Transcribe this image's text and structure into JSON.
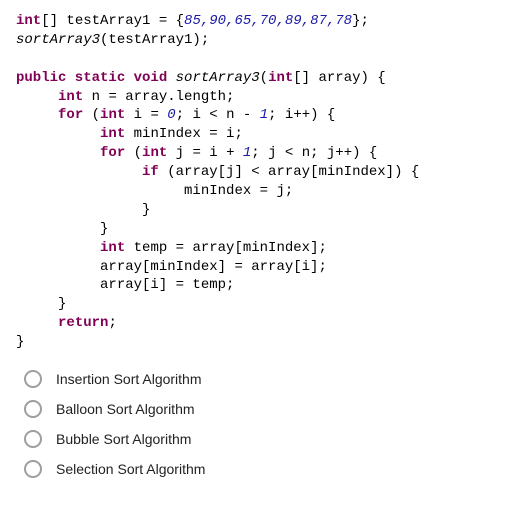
{
  "code": {
    "line1_a": "int",
    "line1_b": "[] testArray1 = {",
    "line1_nums": "85,90,65,70,89,87,78",
    "line1_c": "};",
    "line2_fn": "sortArray3",
    "line2_rest": "(testArray1);",
    "line3_a": "public static void ",
    "line3_fn": "sortArray3",
    "line3_b": "(",
    "line3_c": "int",
    "line3_d": "[] array) {",
    "line4_a": "int",
    "line4_b": " n = array.length;",
    "line5_a": "for",
    "line5_b": " (",
    "line5_c": "int",
    "line5_d": " i = ",
    "line5_n0": "0",
    "line5_e": "; i < n - ",
    "line5_n1": "1",
    "line5_f": "; i++) {",
    "line6_a": "int",
    "line6_b": " minIndex = i;",
    "line7_a": "for",
    "line7_b": " (",
    "line7_c": "int",
    "line7_d": " j = i + ",
    "line7_n1": "1",
    "line7_e": "; j < n; j++) {",
    "line8_a": "if",
    "line8_b": " (array[j] < array[minIndex]) {",
    "line9": "minIndex = j;",
    "line10": "}",
    "line11": "}",
    "line12_a": "int",
    "line12_b": " temp = array[minIndex];",
    "line13": "array[minIndex] = array[i];",
    "line14": "array[i] = temp;",
    "line15": "}",
    "line16": "return",
    "line16b": ";",
    "line17": "}"
  },
  "options": [
    {
      "label": "Insertion Sort Algorithm"
    },
    {
      "label": "Balloon Sort Algorithm"
    },
    {
      "label": "Bubble Sort Algorithm"
    },
    {
      "label": "Selection Sort Algorithm"
    }
  ]
}
